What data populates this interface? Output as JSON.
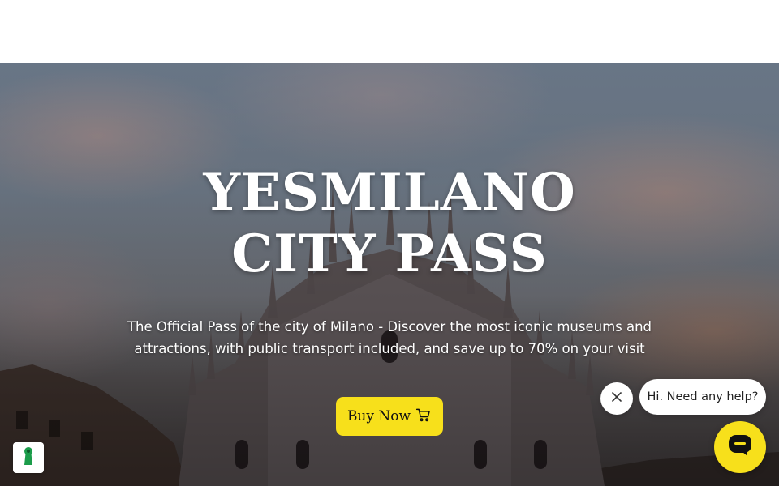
{
  "hero": {
    "title": "YESMILANO CITY PASS",
    "subtitle": "The Official Pass of the city of Milano - Discover the most iconic museums and attractions, with public transport included, and save up to 70% on your visit",
    "cta_label": "Buy Now",
    "cta_icon": "cart-icon"
  },
  "chat": {
    "greeting": "Hi. Need any help?",
    "close_icon": "close-icon",
    "launcher_icon": "chat-icon"
  },
  "cookie": {
    "icon": "accessibility-keyhole-icon"
  },
  "colors": {
    "accent": "#f7e01b",
    "header_bg": "#ffffff",
    "badge_icon": "#1b9c4a"
  }
}
